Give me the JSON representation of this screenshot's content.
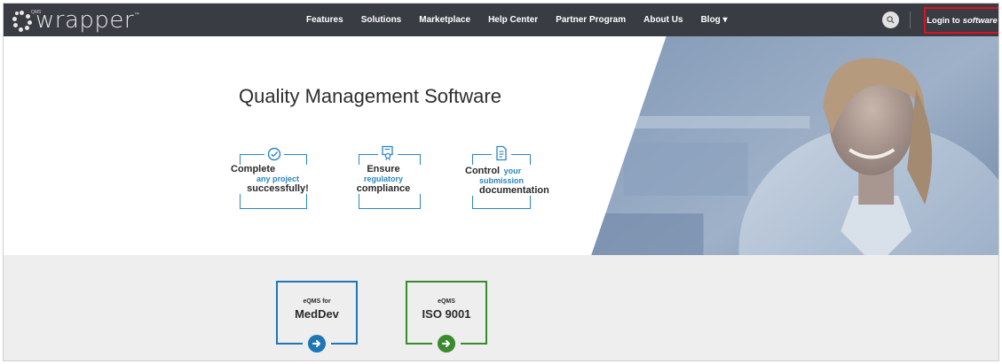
{
  "header": {
    "logo_text": "wrapper",
    "logo_superscript": "QMS",
    "logo_tm": "™",
    "nav_items": [
      {
        "label": "Features"
      },
      {
        "label": "Solutions"
      },
      {
        "label": "Marketplace"
      },
      {
        "label": "Help Center"
      },
      {
        "label": "Partner Program"
      },
      {
        "label": "About Us"
      },
      {
        "label": "Blog ▾"
      }
    ],
    "login_prefix": "Login to",
    "login_emphasis": "software",
    "colors": {
      "bar": "#3a3c44",
      "login_outline": "#e01020"
    }
  },
  "hero": {
    "title": "Quality Management Software",
    "features": [
      {
        "icon": "checkmark-circle-icon",
        "line1": "Complete",
        "line2": "any project",
        "line3": "successfully!"
      },
      {
        "icon": "certificate-icon",
        "line1": "Ensure",
        "line2": "regulatory",
        "line3": "compliance"
      },
      {
        "icon": "document-icon",
        "line1": "Control",
        "line1b": "your",
        "line2": "submission",
        "line3": "documentation"
      }
    ],
    "colors": {
      "feature_blue": "#2a86c0"
    }
  },
  "ctas": [
    {
      "small": "eQMS for",
      "big": "MedDev",
      "color": "#1e76b4",
      "icon": "arrow-right-circle-icon"
    },
    {
      "small": "eQMS",
      "big": "ISO 9001",
      "color": "#3a8a2e",
      "icon": "arrow-right-circle-icon"
    }
  ]
}
